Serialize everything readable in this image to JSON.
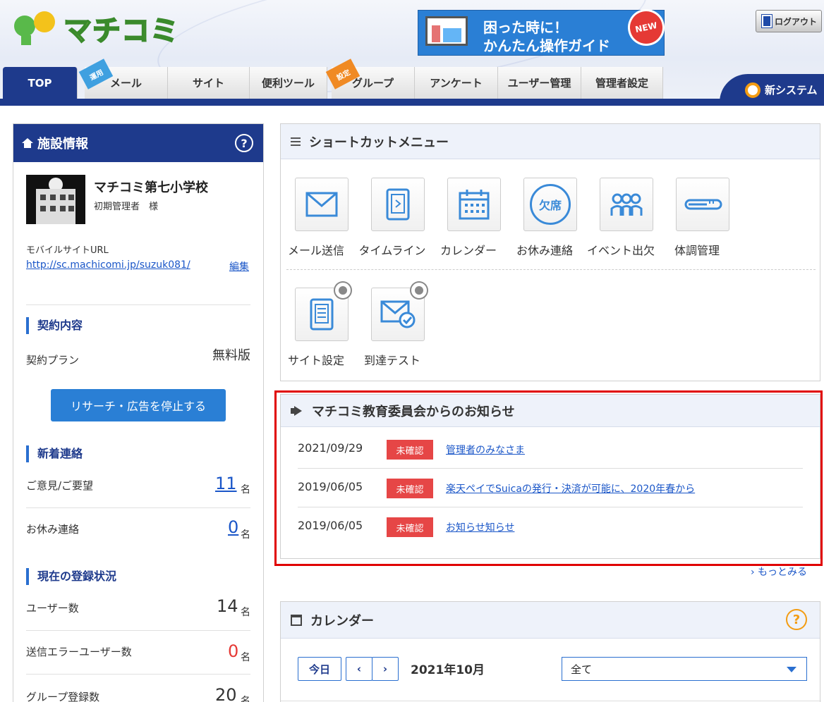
{
  "header": {
    "logo_text": "マチコミ",
    "banner": {
      "line1": "困った時に！",
      "line2": "かんたん操作ガイド",
      "badge": "NEW"
    },
    "logout_label": "ログアウト",
    "new_system_label": "新システム"
  },
  "nav": {
    "tabs": [
      {
        "label": "TOP",
        "active": true
      },
      {
        "label": "メール",
        "corner": "運用"
      },
      {
        "label": "サイト"
      },
      {
        "label": "便利ツール"
      },
      {
        "label": "グループ",
        "corner": "設定"
      },
      {
        "label": "アンケート"
      },
      {
        "label": "ユーザー管理"
      },
      {
        "label": "管理者設定"
      }
    ]
  },
  "facility": {
    "title": "施設情報",
    "help": "?",
    "school_name": "マチコミ第七小学校",
    "admin": "初期管理者　様",
    "mobile_url_label": "モバイルサイトURL",
    "mobile_url": "http://sc.machicomi.jp/suzuk081/",
    "edit_label": "編集",
    "contract_title": "契約内容",
    "plan_label": "契約プラン",
    "plan_value": "無料版",
    "stop_button": "リサーチ・広告を停止する",
    "new_contacts_title": "新着連絡",
    "requests_label": "ご意見/ご要望",
    "requests_count": "11",
    "absence_label": "お休み連絡",
    "absence_count": "0",
    "registration_title": "現在の登録状況",
    "users_label": "ユーザー数",
    "users_count": "14",
    "error_users_label": "送信エラーユーザー数",
    "error_users_count": "0",
    "groups_label": "グループ登録数",
    "groups_count": "20",
    "unit": "名"
  },
  "shortcut": {
    "title": "ショートカットメニュー",
    "items": [
      {
        "label": "メール送信",
        "icon": "mail-icon"
      },
      {
        "label": "タイムライン",
        "icon": "tablet-icon"
      },
      {
        "label": "カレンダー",
        "icon": "calendar-icon"
      },
      {
        "label": "お休み連絡",
        "icon": "absence-icon",
        "glyph": "欠席"
      },
      {
        "label": "イベント出欠",
        "icon": "people-icon"
      },
      {
        "label": "体調管理",
        "icon": "thermometer-icon"
      },
      {
        "label": "サイト設定",
        "icon": "site-settings-icon"
      },
      {
        "label": "到達テスト",
        "icon": "mail-check-icon"
      }
    ]
  },
  "notices": {
    "title": "マチコミ教育委員会からのお知らせ",
    "items": [
      {
        "date": "2021/09/29",
        "status": "未確認",
        "title": "管理者のみなさま"
      },
      {
        "date": "2019/06/05",
        "status": "未確認",
        "title": "楽天ペイでSuicaの発行・決済が可能に、2020年春から"
      },
      {
        "date": "2019/06/05",
        "status": "未確認",
        "title": "お知らせ知らせ"
      }
    ],
    "more_label": "› もっとみる"
  },
  "calendar": {
    "title": "カレンダー",
    "help": "?",
    "today_label": "今日",
    "prev": "‹",
    "next": "›",
    "month": "2021年10月",
    "filter_value": "全て"
  },
  "colors": {
    "navy": "#1e3a8c",
    "accent_blue": "#2a7fd5",
    "alert_red": "#e64646",
    "highlight_border": "#e00000"
  }
}
